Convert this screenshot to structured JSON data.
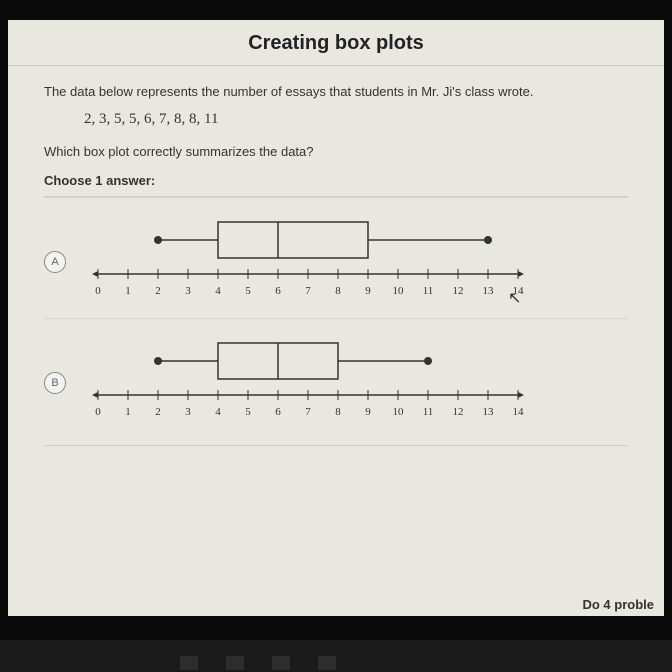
{
  "title": "Creating box plots",
  "intro": "The data below represents the number of essays that students in Mr. Ji's class wrote.",
  "data_list": "2, 3, 5, 5, 6, 7, 8, 8, 11",
  "question": "Which box plot correctly summarizes the data?",
  "choose": "Choose 1 answer:",
  "options": [
    {
      "label": "A"
    },
    {
      "label": "B"
    }
  ],
  "footer": "Do 4 proble",
  "chart_data": [
    {
      "type": "boxplot",
      "label": "A",
      "axis": {
        "min": 0,
        "max": 14,
        "step": 1
      },
      "min": 2,
      "q1": 4,
      "median": 6,
      "q3": 9,
      "max": 13,
      "ticks": [
        "0",
        "1",
        "2",
        "3",
        "4",
        "5",
        "6",
        "7",
        "8",
        "9",
        "10",
        "11",
        "12",
        "13",
        "14"
      ]
    },
    {
      "type": "boxplot",
      "label": "B",
      "axis": {
        "min": 0,
        "max": 14,
        "step": 1
      },
      "min": 2,
      "q1": 4,
      "median": 6,
      "q3": 8,
      "max": 11,
      "ticks": [
        "0",
        "1",
        "2",
        "3",
        "4",
        "5",
        "6",
        "7",
        "8",
        "9",
        "10",
        "11",
        "12",
        "13",
        "14"
      ]
    }
  ]
}
